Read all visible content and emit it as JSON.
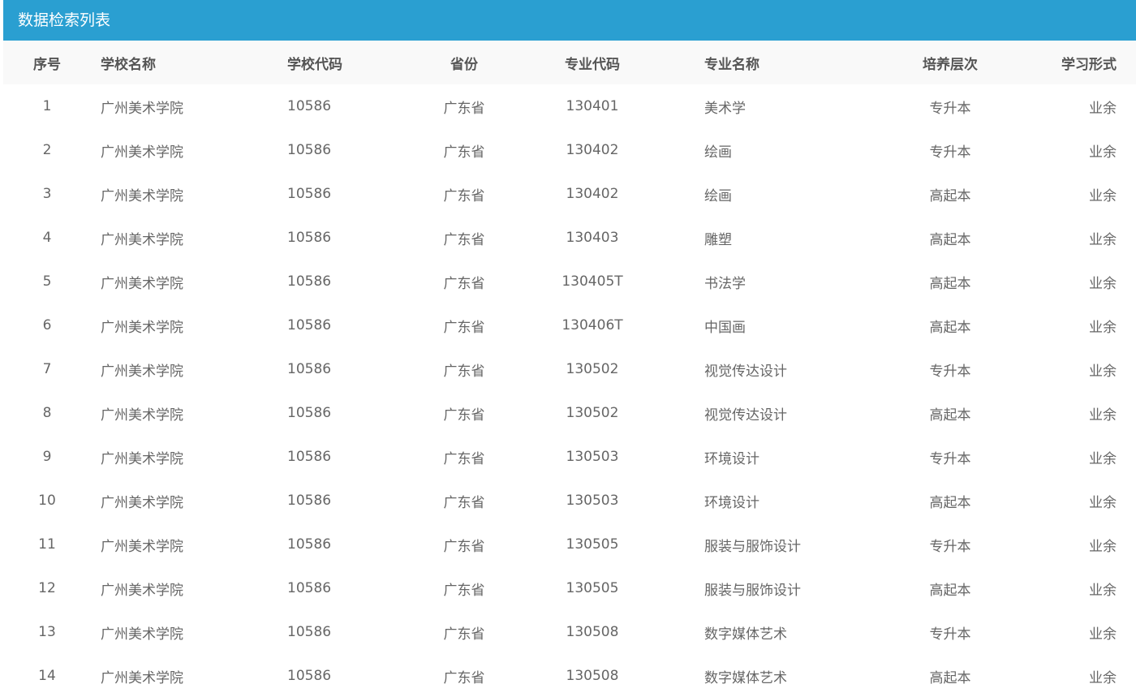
{
  "panel": {
    "title": "数据检索列表"
  },
  "columns": [
    "序号",
    "学校名称",
    "学校代码",
    "省份",
    "专业代码",
    "专业名称",
    "培养层次",
    "学习形式"
  ],
  "rows": [
    [
      "1",
      "广州美术学院",
      "10586",
      "广东省",
      "130401",
      "美术学",
      "专升本",
      "业余"
    ],
    [
      "2",
      "广州美术学院",
      "10586",
      "广东省",
      "130402",
      "绘画",
      "专升本",
      "业余"
    ],
    [
      "3",
      "广州美术学院",
      "10586",
      "广东省",
      "130402",
      "绘画",
      "高起本",
      "业余"
    ],
    [
      "4",
      "广州美术学院",
      "10586",
      "广东省",
      "130403",
      "雕塑",
      "高起本",
      "业余"
    ],
    [
      "5",
      "广州美术学院",
      "10586",
      "广东省",
      "130405T",
      "书法学",
      "高起本",
      "业余"
    ],
    [
      "6",
      "广州美术学院",
      "10586",
      "广东省",
      "130406T",
      "中国画",
      "高起本",
      "业余"
    ],
    [
      "7",
      "广州美术学院",
      "10586",
      "广东省",
      "130502",
      "视觉传达设计",
      "专升本",
      "业余"
    ],
    [
      "8",
      "广州美术学院",
      "10586",
      "广东省",
      "130502",
      "视觉传达设计",
      "高起本",
      "业余"
    ],
    [
      "9",
      "广州美术学院",
      "10586",
      "广东省",
      "130503",
      "环境设计",
      "专升本",
      "业余"
    ],
    [
      "10",
      "广州美术学院",
      "10586",
      "广东省",
      "130503",
      "环境设计",
      "高起本",
      "业余"
    ],
    [
      "11",
      "广州美术学院",
      "10586",
      "广东省",
      "130505",
      "服装与服饰设计",
      "专升本",
      "业余"
    ],
    [
      "12",
      "广州美术学院",
      "10586",
      "广东省",
      "130505",
      "服装与服饰设计",
      "高起本",
      "业余"
    ],
    [
      "13",
      "广州美术学院",
      "10586",
      "广东省",
      "130508",
      "数字媒体艺术",
      "专升本",
      "业余"
    ],
    [
      "14",
      "广州美术学院",
      "10586",
      "广东省",
      "130508",
      "数字媒体艺术",
      "高起本",
      "业余"
    ]
  ]
}
